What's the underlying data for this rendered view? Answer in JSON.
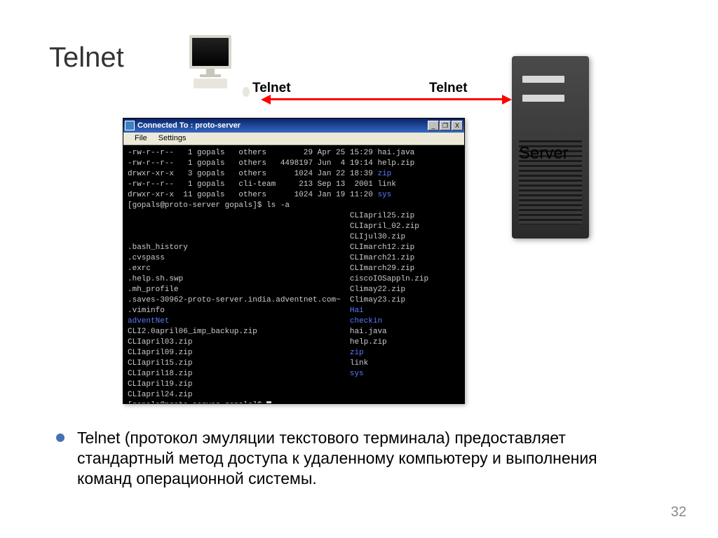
{
  "slide": {
    "title": "Telnet",
    "page_number": "32"
  },
  "diagram": {
    "label_left": "Telnet",
    "label_right": "Telnet",
    "server_label": "Server"
  },
  "terminal": {
    "titlebar": "Connected To : proto-server",
    "menu_file": "File",
    "menu_settings": "Settings",
    "win_min": "_",
    "win_max": "❐",
    "win_close": "X",
    "listing": [
      "-rw-r--r--   1 gopals   others        29 Apr 25 15:29 hai.java",
      "-rw-r--r--   1 gopals   others   4498197 Jun  4 19:14 help.zip",
      "drwxr-xr-x   3 gopals   others      1024 Jan 22 18:39 ",
      "-rw-r--r--   1 gopals   cli-team     213 Sep 13  2001 link",
      "drwxr-xr-x  11 gopals   others      1024 Jan 19 11:20 "
    ],
    "listing_blue": [
      "",
      "",
      "zip",
      "",
      "sys"
    ],
    "prompt1": "[gopals@proto-server gopals]$ ls -a",
    "cols": {
      "left": [
        "",
        "",
        "",
        ".bash_history",
        ".cvspass",
        ".exrc",
        ".help.sh.swp",
        ".mh_profile",
        ".saves-30962-proto-server.india.adventnet.com~",
        ".viminfo",
        "adventNet",
        "CLI2.0april06_imp_backup.zip",
        "CLIapril03.zip",
        "CLIapril09.zip",
        "CLIapril15.zip",
        "CLIapril18.zip",
        "CLIapril19.zip",
        "CLIapril24.zip"
      ],
      "right": [
        "CLIapril25.zip",
        "CLIapril_02.zip",
        "CLIjul30.zip",
        "CLImarch12.zip",
        "CLImarch21.zip",
        "CLImarch29.zip",
        "ciscoIOSappln.zip",
        "Climay22.zip",
        "Climay23.zip",
        "Hai",
        "checkin",
        "hai.java",
        "help.zip",
        "zip",
        "link",
        "sys",
        "",
        ""
      ],
      "left_blue_indices": [
        10
      ],
      "right_blue_indices": [
        9,
        10,
        13,
        15
      ]
    },
    "prompt2": "[gopals@proto-server gopals]$ "
  },
  "description": "Telnet (протокол эмуляции текстового терминала) предоставляет стандартный метод доступа к удаленному компьютеру и выполнения команд операционной системы."
}
